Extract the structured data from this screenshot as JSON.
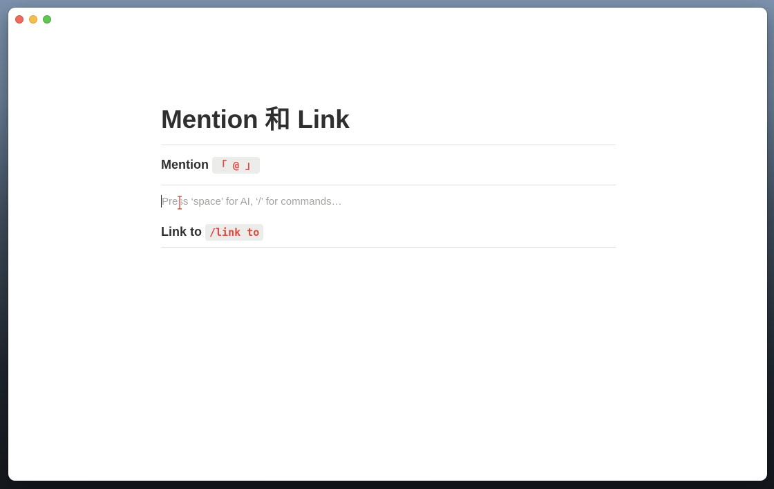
{
  "window": {
    "controls": [
      "close",
      "minimize",
      "zoom"
    ]
  },
  "page": {
    "title": "Mention 和 Link",
    "blocks": [
      {
        "heading": "Mention",
        "code": "「 @ 」"
      },
      {
        "placeholder": "Press ‘space’ for AI, ‘/’ for commands…"
      },
      {
        "heading": "Link to",
        "code": "/link to"
      }
    ]
  },
  "colors": {
    "text": "#2f2f2f",
    "code": "#e0473f",
    "code_bg": "#ececea",
    "placeholder": "#a3a3a0",
    "divider": "#dedede"
  },
  "icons": {
    "cursor": "text-cursor-icon"
  }
}
